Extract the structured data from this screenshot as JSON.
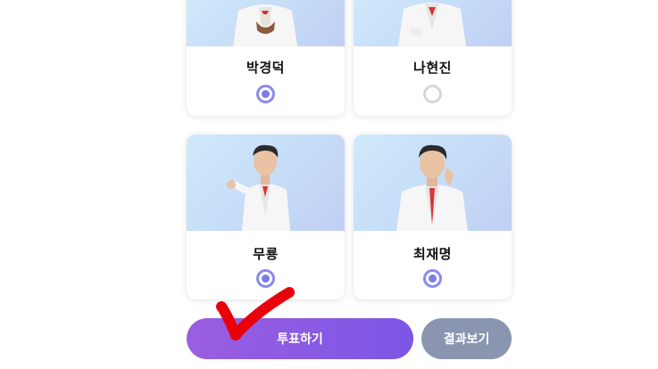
{
  "candidates": [
    {
      "name": "박경덕",
      "selected": true
    },
    {
      "name": "나현진",
      "selected": false
    },
    {
      "name": "무룡",
      "selected": true
    },
    {
      "name": "최재명",
      "selected": true
    }
  ],
  "buttons": {
    "vote_label": "투표하기",
    "result_label": "결과보기"
  },
  "colors": {
    "accent": "#7c56e6",
    "radio_selected": "#8a8aeb",
    "radio_unselected": "#d6d6d6",
    "result_button": "#8a96b0",
    "check_mark": "#e8000b"
  },
  "icons": {
    "check_mark": "red-hand-drawn-check-icon"
  }
}
